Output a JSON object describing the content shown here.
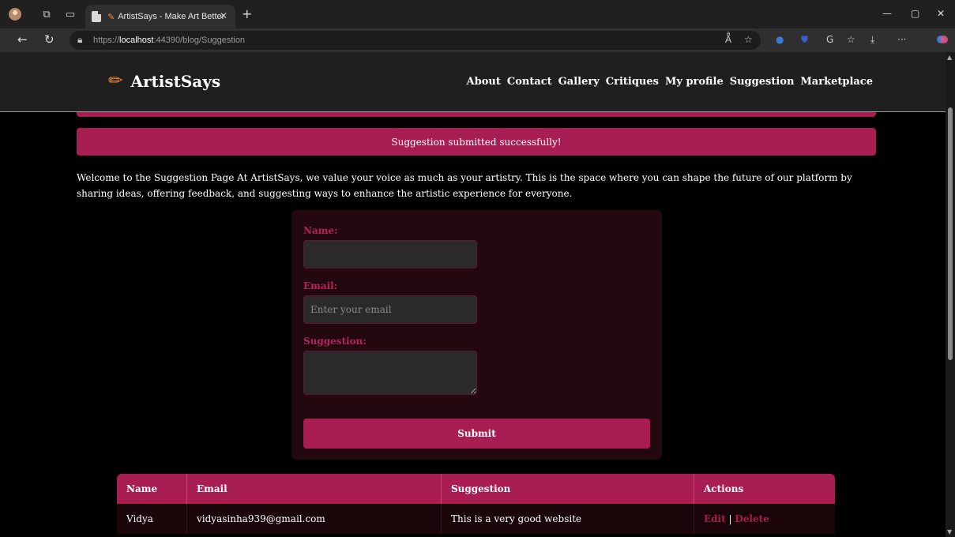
{
  "browser": {
    "tab_title": "ArtistSays - Make Art Better",
    "url_scheme": "https://",
    "url_host": "localhost",
    "url_rest": ":44390/blog/Suggestion",
    "icons": [
      "profile-icon",
      "workspaces-icon",
      "tab-actions-icon",
      "page-icon",
      "close-icon",
      "plus-icon",
      "minimize-icon",
      "restore-icon",
      "close-window-icon",
      "back-icon",
      "refresh-icon",
      "lock-icon",
      "read-aloud-icon",
      "favorite-star-icon",
      "extension-icon",
      "shield-icon",
      "collections-icon",
      "favorites-icon",
      "downloads-icon",
      "more-icon",
      "copilot-icon"
    ]
  },
  "site": {
    "brand": "ArtistSays",
    "nav": [
      "About",
      "Contact",
      "Gallery",
      "Critiques",
      "My profile",
      "Suggestion",
      "Marketplace"
    ]
  },
  "alert": "Suggestion submitted successfully!",
  "intro": "Welcome to the Suggestion Page At ArtistSays, we value your voice as much as your artistry. This is the space where you can shape the future of our platform by sharing ideas, offering feedback, and suggesting ways to enhance the artistic experience for everyone.",
  "form": {
    "name_label": "Name:",
    "name_value": "",
    "email_label": "Email:",
    "email_placeholder": "Enter your email",
    "suggestion_label": "Suggestion:",
    "suggestion_value": "",
    "submit_label": "Submit"
  },
  "table": {
    "headers": [
      "Name",
      "Email",
      "Suggestion",
      "Actions"
    ],
    "rows": [
      {
        "name": "Vidya",
        "email": "vidyasinha939@gmail.com",
        "suggestion": "This is a very good website",
        "edit": "Edit",
        "sep": "|",
        "delete": "Delete"
      }
    ]
  },
  "colors": {
    "accent": "#a81d52",
    "brand_pencil": "#f28c2b",
    "card_bg": "#24080f"
  }
}
